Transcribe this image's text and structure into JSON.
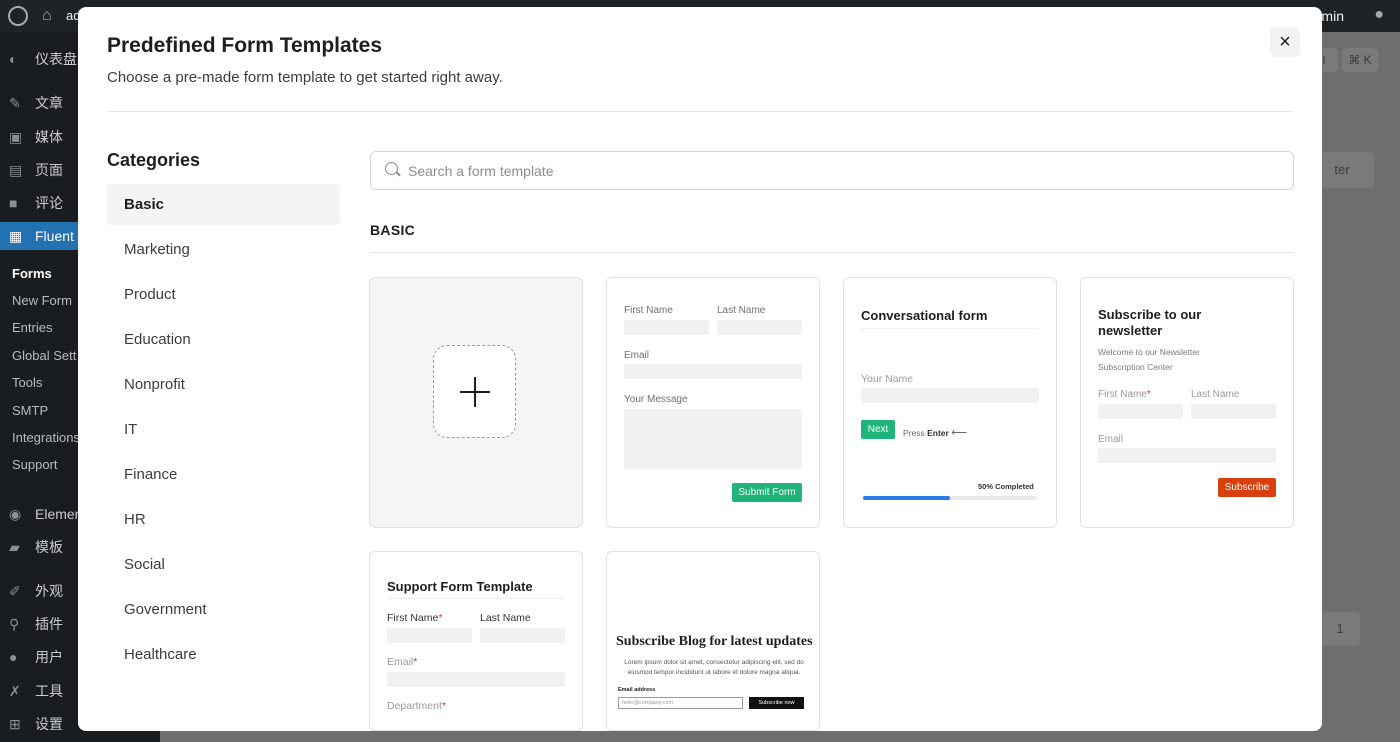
{
  "admin_bar": {
    "site": "ad",
    "user": "admin"
  },
  "sidebar": {
    "items": [
      {
        "label": "仪表盘",
        "icon": "dashboard-icon"
      },
      {
        "label": "文章",
        "icon": "pin-icon"
      },
      {
        "label": "媒体",
        "icon": "media-icon"
      },
      {
        "label": "页面",
        "icon": "page-icon"
      },
      {
        "label": "评论",
        "icon": "comment-icon"
      },
      {
        "label": "Fluent",
        "icon": "fluent-icon"
      },
      {
        "label": "Elemen",
        "icon": "elementor-icon"
      },
      {
        "label": "模板",
        "icon": "folder-icon"
      },
      {
        "label": "外观",
        "icon": "brush-icon"
      },
      {
        "label": "插件",
        "icon": "plugin-icon"
      },
      {
        "label": "用户",
        "icon": "user-icon"
      },
      {
        "label": "工具",
        "icon": "wrench-icon"
      },
      {
        "label": "设置",
        "icon": "settings-icon"
      }
    ],
    "submenu": [
      "Forms",
      "New Form",
      "Entries",
      "Global Sett",
      "Tools",
      "SMTP",
      "Integrations",
      "Support"
    ]
  },
  "background": {
    "shortcut_left": "l",
    "shortcut_right": "⌘ K",
    "filter": "ter",
    "page_num": "1"
  },
  "modal": {
    "title": "Predefined Form Templates",
    "subtitle": "Choose a pre-made form template to get started right away.",
    "close_label": "×",
    "categories_title": "Categories",
    "categories": [
      "Basic",
      "Marketing",
      "Product",
      "Education",
      "Nonprofit",
      "IT",
      "Finance",
      "HR",
      "Social",
      "Government",
      "Healthcare"
    ],
    "search_placeholder": "Search a form template",
    "section_title": "BASIC",
    "contact": {
      "first_name": "First Name",
      "last_name": "Last Name",
      "email": "Email",
      "message": "Your Message",
      "submit": "Submit Form"
    },
    "conversational": {
      "title": "Conversational form",
      "your_name": "Your Name",
      "next": "Next",
      "press": "Press",
      "enter": "Enter",
      "progress_text": "50% Completed",
      "progress": 0.5
    },
    "newsletter": {
      "title": "Subscribe to our newsletter",
      "desc": "Welcome to our Newsletter Subscription Center",
      "first_name": "First Name",
      "last_name": "Last Name",
      "email": "Email",
      "subscribe": "Subscribe",
      "required_mark": "*"
    },
    "support": {
      "title": "Support Form Template",
      "first_name": "First Name",
      "last_name": "Last Name",
      "email": "Email",
      "department": "Department",
      "required_mark": "*"
    },
    "blog": {
      "title": "Subscribe Blog for latest updates",
      "desc": "Lorem ipsum dolor sit amet, consectetur adipiscing elit, sed do eiusmod tempor incididunt ut labore et dolore magna aliqua.",
      "email_label": "Email address",
      "email_placeholder": "hello@company.com",
      "button": "Subscribe now"
    }
  },
  "colors": {
    "accent_green": "#1fb47a",
    "subscribe_red": "#d8400f",
    "progress_blue": "#2d7bea",
    "wp_blue": "#2271b1"
  }
}
